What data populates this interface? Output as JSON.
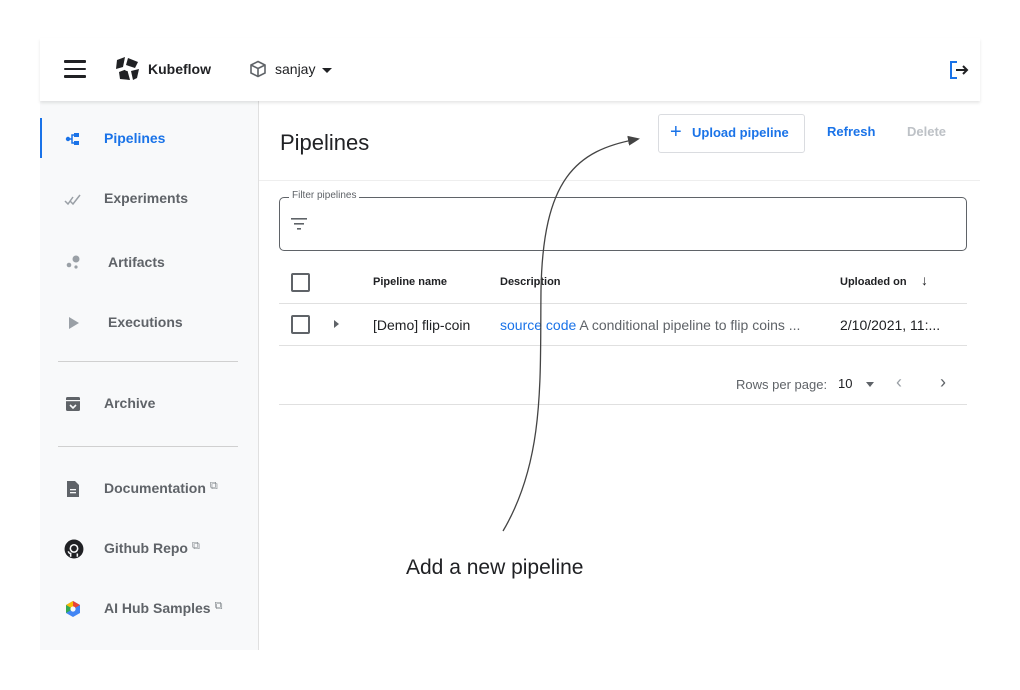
{
  "header": {
    "app_name": "Kubeflow",
    "namespace": "sanjay",
    "icons": {
      "menu": "hamburger-menu-icon",
      "logo": "kubeflow-logo-icon",
      "namespace": "cube-icon",
      "logout": "logout-icon"
    }
  },
  "sidebar": {
    "items": [
      {
        "label": "Pipelines",
        "icon": "pipelines-icon",
        "active": true
      },
      {
        "label": "Experiments",
        "icon": "experiments-icon"
      },
      {
        "label": "Artifacts",
        "icon": "artifacts-icon"
      },
      {
        "label": "Executions",
        "icon": "play-icon"
      },
      {
        "label": "Archive",
        "icon": "archive-icon"
      },
      {
        "label": "Documentation",
        "icon": "document-icon",
        "external": true
      },
      {
        "label": "Github Repo",
        "icon": "github-icon",
        "external": true
      },
      {
        "label": "AI Hub Samples",
        "icon": "ai-hub-icon",
        "external": true
      }
    ],
    "external_link_glyph": "⧉"
  },
  "main": {
    "title": "Pipelines",
    "toolbar": {
      "upload_label": "Upload pipeline",
      "refresh_label": "Refresh",
      "delete_label": "Delete"
    },
    "filter": {
      "label": "Filter pipelines",
      "value": ""
    },
    "table": {
      "columns": [
        "Pipeline name",
        "Description",
        "Uploaded on"
      ],
      "sort_glyph": "↓",
      "rows": [
        {
          "name": "[Demo] flip-coin",
          "description_link": "source code",
          "description": "A conditional pipeline to flip coins ...",
          "uploaded_on": "2/10/2021, 11:..."
        }
      ]
    },
    "pagination": {
      "rows_per_page_label": "Rows per page:",
      "rows_per_page": "10",
      "prev_glyph": "‹",
      "next_glyph": "›"
    }
  },
  "annotation": {
    "text": "Add a new pipeline"
  },
  "colors": {
    "accent": "#1a73e8",
    "sidebar_bg": "#f8f9fa",
    "text_primary": "#202124",
    "text_secondary": "#5f6368",
    "disabled": "#bdc1c6"
  }
}
